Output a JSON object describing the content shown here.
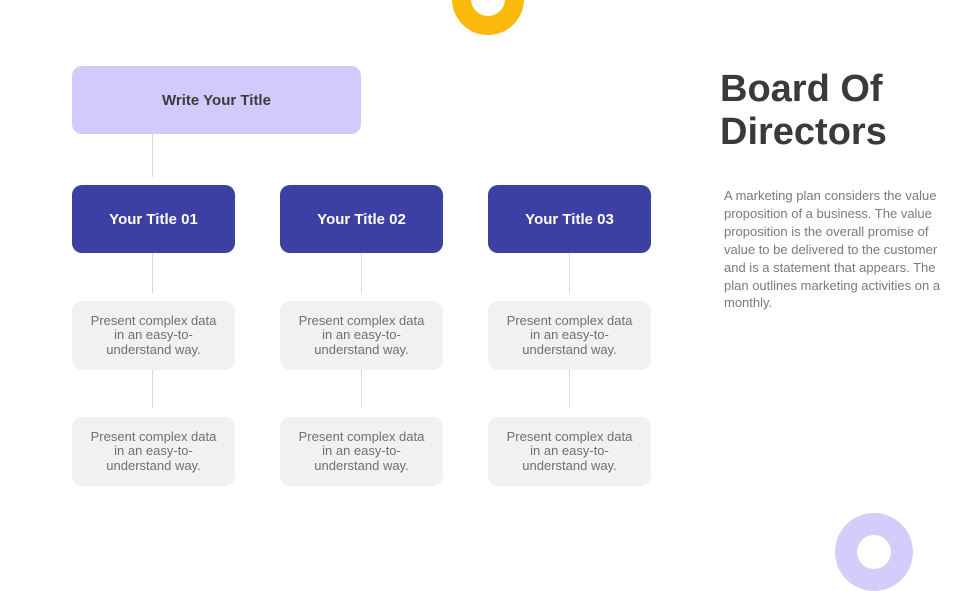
{
  "colors": {
    "root_fill": "#d0cbfb",
    "title_fill": "#3d40a3",
    "card_fill": "#f1f1f1",
    "accent_yellow": "#fbb90d",
    "accent_lavender": "#d3cdfb",
    "heading_text": "#3a3a3a",
    "body_text": "#7a7a7a"
  },
  "diagram": {
    "root": {
      "label": "Write Your Title"
    },
    "columns": [
      {
        "title": "Your Title 01",
        "cards": [
          "Present complex data in an easy-to-understand way.",
          "Present complex data in an easy-to-understand way."
        ]
      },
      {
        "title": "Your Title 02",
        "cards": [
          "Present complex data in an easy-to-understand way.",
          "Present complex data in an easy-to-understand way."
        ]
      },
      {
        "title": "Your Title 03",
        "cards": [
          "Present complex data in an easy-to-understand way.",
          "Present complex data in an easy-to-understand way."
        ]
      }
    ]
  },
  "sidebar": {
    "heading": "Board Of Directors",
    "description": "A marketing plan considers the value proposition of a business. The value proposition is the overall promise of value to be delivered to the customer and is a statement that appears. The plan outlines marketing activities on a monthly."
  },
  "decorations": {
    "top_ring": "yellow-ring",
    "bottom_ring": "lavender-ring"
  }
}
